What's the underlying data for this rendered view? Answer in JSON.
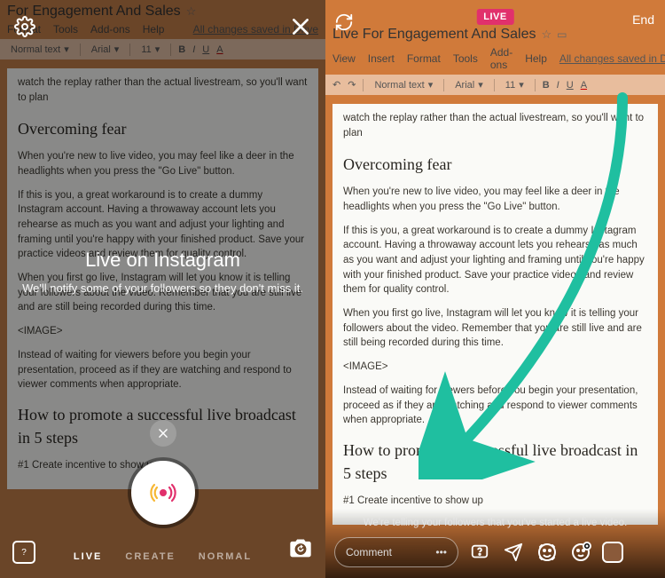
{
  "background_doc": {
    "title": "Live For Engagement And Sales",
    "title_left_partial": "For Engagement And Sales",
    "menubar": [
      "View",
      "Insert",
      "Format",
      "Tools",
      "Add-ons",
      "Help"
    ],
    "menubar_left": [
      "Format",
      "Tools",
      "Add-ons",
      "Help"
    ],
    "saved_status": "All changes saved in Drive",
    "toolbar": {
      "style": "Normal text",
      "font": "Arial",
      "size": "11",
      "bold": "B",
      "italic": "I",
      "underline": "U",
      "color": "A"
    },
    "lead_line": "watch the replay rather than the actual livestream, so you'll want to plan",
    "h2_1": "Overcoming fear",
    "p1": "When you're new to live video, you may feel like a deer in the headlights when you press the \"Go Live\" button.",
    "p2": "If this is you, a great workaround is to create a dummy Instagram account. Having a throwaway account lets you rehearse as much as you want and adjust your lighting and framing until you're happy with your finished product. Save your practice videos and review them for quality control.",
    "p3": "When you first go live, Instagram will let you know it is telling your followers about the video. Remember that you are still live and are still being recorded during this time.",
    "img_ph": "<IMAGE>",
    "p4": "Instead of waiting for viewers before you begin your presentation, proceed as if they are watching and respond to viewer comments when appropriate.",
    "h2_2": "How to promote a successful live broadcast in 5 steps",
    "p5": "#1  Create incentive to show up"
  },
  "left_screen": {
    "headline": "Live on Instagram",
    "subtext": "We'll notify some of your followers so they don't miss it.",
    "modes": {
      "live": "LIVE",
      "create": "CREATE",
      "normal": "NORMAL"
    },
    "gallery_placeholder": "?"
  },
  "right_screen": {
    "live_badge": "LIVE",
    "end_label": "End",
    "status_text": "We're telling your followers that you've started a live video.",
    "comment_placeholder": "Comment",
    "comment_more": "•••"
  },
  "arrow": {
    "color": "#1fbfa0"
  },
  "icons": {
    "settings": "settings-icon",
    "close": "close-icon",
    "flip": "flip-camera-icon",
    "camera_switch": "camera-switch-icon",
    "gallery": "gallery-icon",
    "question_box": "question-icon",
    "paper_plane": "share-icon",
    "face_filter": "face-filter-icon",
    "smiley": "smiley-icon"
  }
}
